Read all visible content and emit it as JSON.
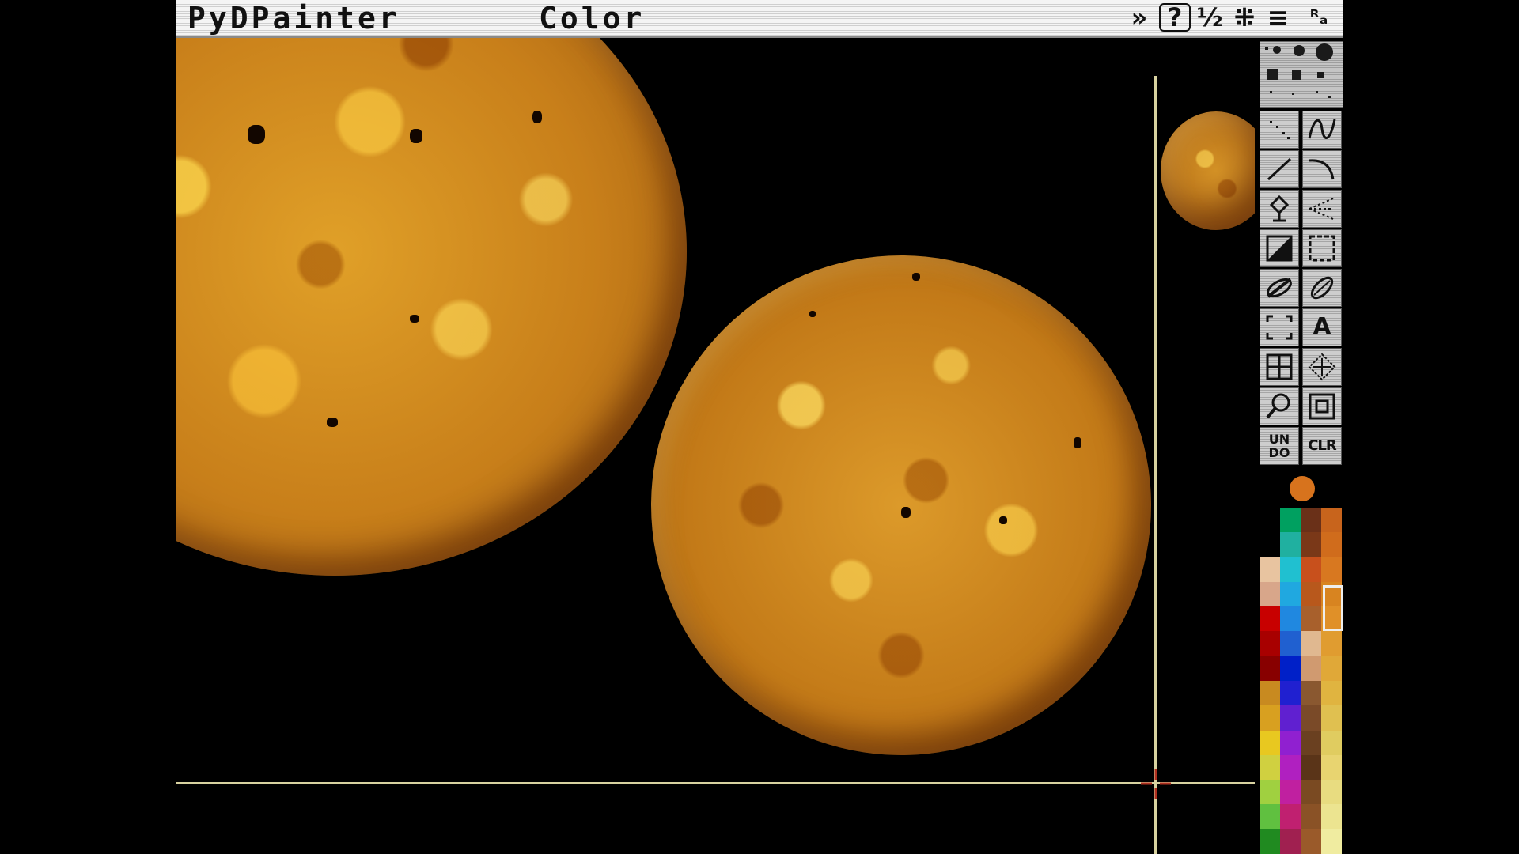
{
  "window": {
    "app_title": "PyDPainter",
    "menu_color": "Color"
  },
  "title_icons": {
    "more": "»",
    "help": "?",
    "fraction": "½",
    "pattern": "⁜",
    "menu": "≡",
    "zoom_label": "ᴿₐ"
  },
  "tools": {
    "undo_label_top": "UN",
    "undo_label_bottom": "DO",
    "clr_label": "CLR",
    "text_label": "A"
  },
  "colors": {
    "current": "#d7731d",
    "crosshair": "#d8d2a0",
    "palette": [
      [
        "#000000",
        "#000000",
        "#e8c4a0",
        "#d8a68a",
        "#c80000",
        "#a80000",
        "#880000",
        "#c88a20",
        "#d8a020",
        "#e8c820",
        "#d0d040",
        "#a0d040",
        "#60c040",
        "#208a20"
      ],
      [
        "#00a060",
        "#20b0a0",
        "#20c0d0",
        "#20a8e0",
        "#2088e0",
        "#2060d0",
        "#0020c8",
        "#2020d0",
        "#6020d0",
        "#9020d0",
        "#b020c0",
        "#c020a0",
        "#c02070",
        "#a02050"
      ],
      [
        "#6a3018",
        "#7a3818",
        "#c8501c",
        "#b8581c",
        "#a8602c",
        "#e0b890",
        "#d09a70",
        "#8a5830",
        "#7a4a28",
        "#6a4020",
        "#5a3418",
        "#7a4a22",
        "#8a5226",
        "#9a5a2a"
      ],
      [
        "#c8641c",
        "#d06c1c",
        "#d87820",
        "#d88420",
        "#e09028",
        "#e09c30",
        "#e0a838",
        "#e0b440",
        "#e0c050",
        "#e0cc60",
        "#e8d470",
        "#e8dc80",
        "#ece490",
        "#f0eca0"
      ]
    ]
  }
}
